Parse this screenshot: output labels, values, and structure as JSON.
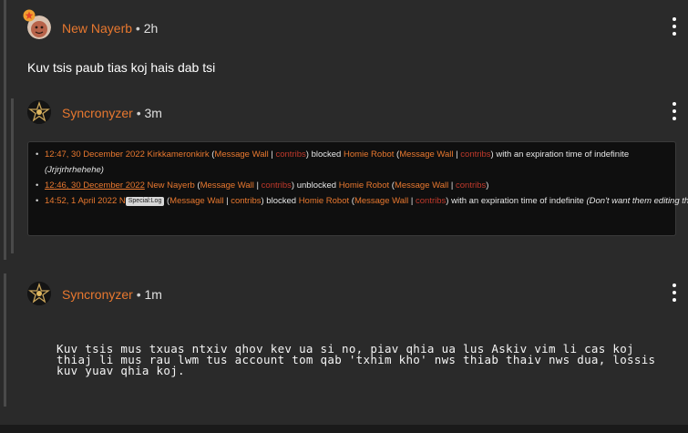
{
  "posts": [
    {
      "username": "New Nayerb",
      "separator": "•",
      "time": "2h",
      "text": "Kuv tsis paub tias koj hais dab tsi"
    },
    {
      "username": "Syncronyzer",
      "separator": "•",
      "time": "3m",
      "log": [
        {
          "timestamp": "12:47, 30 December 2022",
          "user": "Kirkkameronkirk",
          "wall": "Message Wall",
          "contribs": "contribs",
          "action": "blocked",
          "target": "Homie Robot",
          "target_wall": "Message Wall",
          "target_contribs": "contribs",
          "tail": "with an expiration time of indefinite",
          "reason": "(Jrjrjrhrhehehe)"
        },
        {
          "timestamp": "12:46, 30 December 2022",
          "user": "New Nayerb",
          "wall": "Message Wall",
          "contribs": "contribs",
          "action": "unblocked",
          "target": "Homie Robot",
          "target_wall": "Message Wall",
          "target_contribs": "contribs"
        },
        {
          "timestamp": "14:52, 1 April 2022",
          "user_partial": "N",
          "tooltip": "Special:Log",
          "wall": "Message Wall",
          "contribs": "contribs",
          "action": "blocked",
          "target": "Homie Robot",
          "target_wall": "Message Wall",
          "target_contribs": "contribs",
          "tail": "with an expiration time of indefinite",
          "reason": "(Don't want them editing the wiki)"
        }
      ]
    },
    {
      "username": "Syncronyzer",
      "separator": "•",
      "time": "1m",
      "text": "Kuv tsis mus txuas ntxiv qhov kev ua si no, piav qhia ua lus Askiv vim li cas koj thiaj li mus rau lwm tus account tom qab 'txhim kho' nws thiab thaiv nws dua, lossis kuv yuav qhia koj."
    }
  ],
  "icons": {
    "more": "more-vertical-icon"
  },
  "colors": {
    "background": "#2a2a2a",
    "username": "#e8782f",
    "link_red": "#c0392b",
    "log_bg": "#0f0f0f"
  }
}
